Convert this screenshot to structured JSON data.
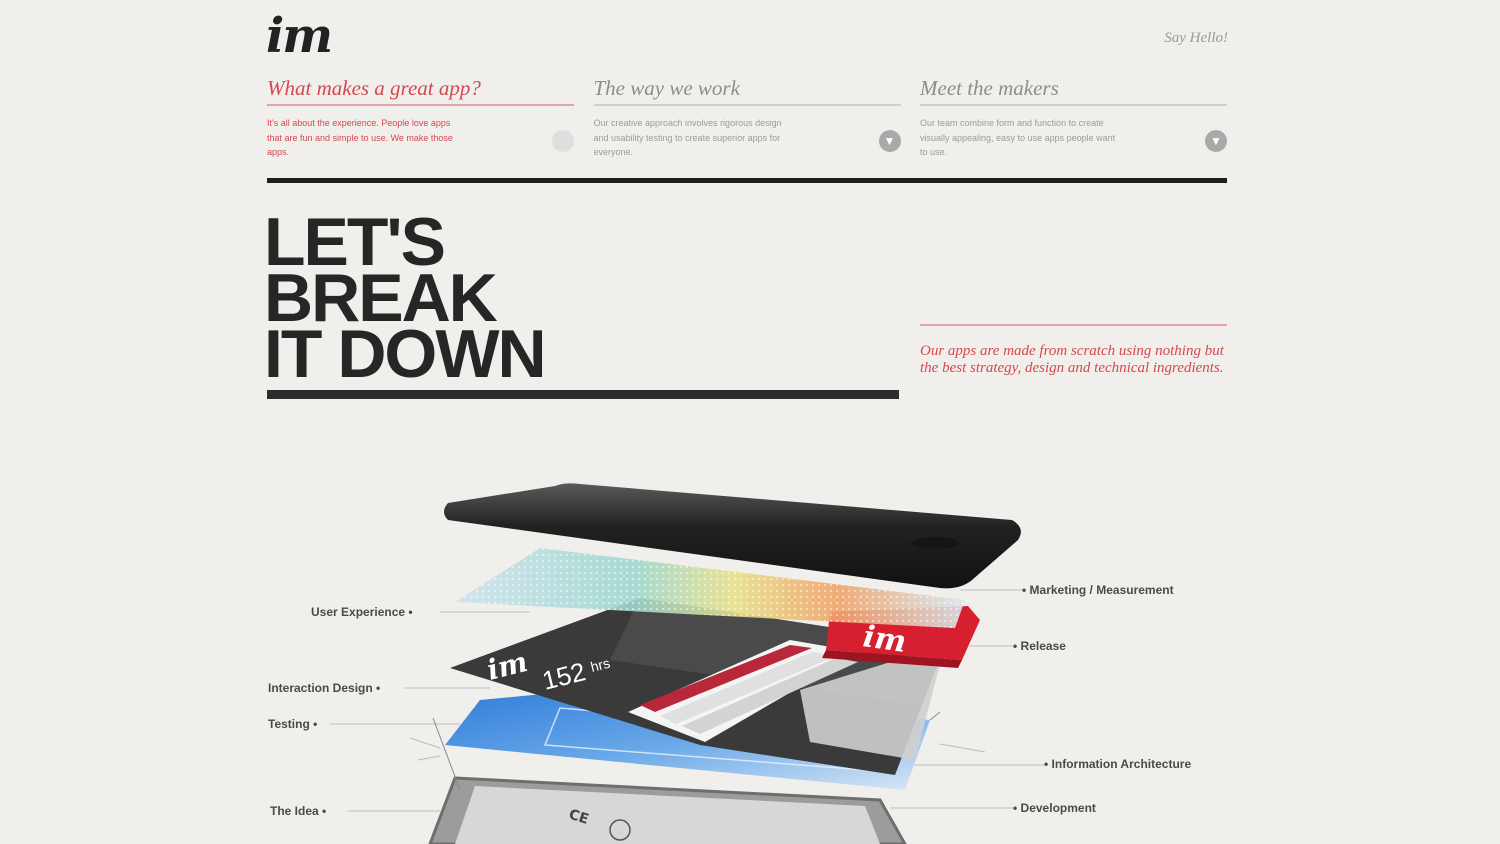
{
  "header": {
    "logo": "im",
    "say_hello": "Say Hello!"
  },
  "nav": [
    {
      "title": "What makes a great app?",
      "desc": "It's all about the experience. People love apps that are fun and simple to use. We make those apps.",
      "active": true
    },
    {
      "title": "The way we work",
      "desc": "Our creative approach involves rigorous design and usability testing to create superior apps for everyone.",
      "active": false
    },
    {
      "title": "Meet the makers",
      "desc": "Our team combine form and function to create visually appealing, easy to use apps people want to use.",
      "active": false
    }
  ],
  "hero": {
    "line1": "LET'S",
    "line2": "BREAK",
    "line3": "IT DOWN",
    "side_text": "Our apps are made from scratch using nothing but the best strategy, design and technical ingredients."
  },
  "diagram": {
    "labels": {
      "user_experience": "User Experience",
      "interaction_design": "Interaction Design",
      "testing": "Testing",
      "the_idea": "The Idea",
      "marketing": "Marketing / Measurement",
      "release": "Release",
      "info_arch": "Information Architecture",
      "development": "Development"
    },
    "screen_logo": "im",
    "screen_hours": "152",
    "screen_hours_unit": "hrs",
    "release_logo": "im",
    "phone_marking": "CE"
  },
  "colors": {
    "accent": "#d6484f",
    "background": "#f0efec",
    "dark": "#262626"
  }
}
